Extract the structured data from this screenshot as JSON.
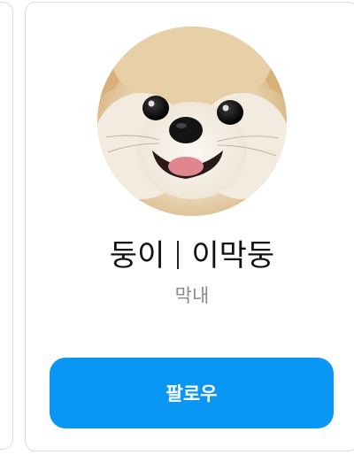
{
  "profile": {
    "name": "둥이",
    "nickname": "이막둥",
    "role": "막내",
    "avatar_icon": "pomeranian-dog-photo"
  },
  "actions": {
    "follow_label": "팔로우"
  },
  "colors": {
    "follow_button": "#0a96f3",
    "role_text": "#8a8a8a",
    "card_border": "#dcdcdc"
  }
}
